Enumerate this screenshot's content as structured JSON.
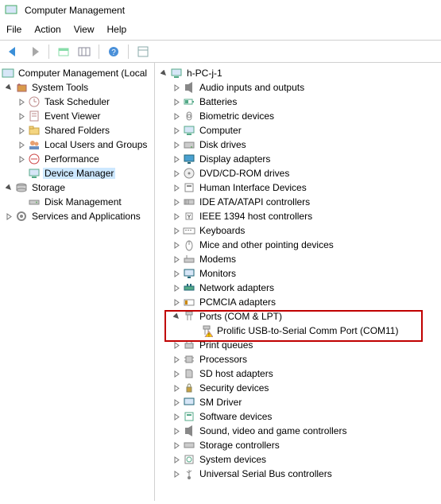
{
  "window": {
    "title": "Computer Management"
  },
  "menu": {
    "file": "File",
    "action": "Action",
    "view": "View",
    "help": "Help"
  },
  "leftTree": {
    "root": "Computer Management (Local",
    "systemTools": "System Tools",
    "taskScheduler": "Task Scheduler",
    "eventViewer": "Event Viewer",
    "sharedFolders": "Shared Folders",
    "localUsers": "Local Users and Groups",
    "performance": "Performance",
    "deviceManager": "Device Manager",
    "storage": "Storage",
    "diskManagement": "Disk Management",
    "services": "Services and Applications"
  },
  "rightTree": {
    "root": "h-PC-j-1",
    "audio": "Audio inputs and outputs",
    "batteries": "Batteries",
    "biometric": "Biometric devices",
    "computer": "Computer",
    "diskDrives": "Disk drives",
    "display": "Display adapters",
    "dvd": "DVD/CD-ROM drives",
    "hid": "Human Interface Devices",
    "ide": "IDE ATA/ATAPI controllers",
    "ieee1394": "IEEE 1394 host controllers",
    "keyboards": "Keyboards",
    "mice": "Mice and other pointing devices",
    "modems": "Modems",
    "monitors": "Monitors",
    "network": "Network adapters",
    "pcmcia": "PCMCIA adapters",
    "ports": "Ports (COM & LPT)",
    "portItem": "Prolific USB-to-Serial Comm Port (COM11)",
    "printQueues": "Print queues",
    "processors": "Processors",
    "sdHost": "SD host adapters",
    "security": "Security devices",
    "smDriver": "SM Driver",
    "software": "Software devices",
    "sound": "Sound, video and game controllers",
    "storageCtrl": "Storage controllers",
    "systemDev": "System devices",
    "usb": "Universal Serial Bus controllers"
  }
}
